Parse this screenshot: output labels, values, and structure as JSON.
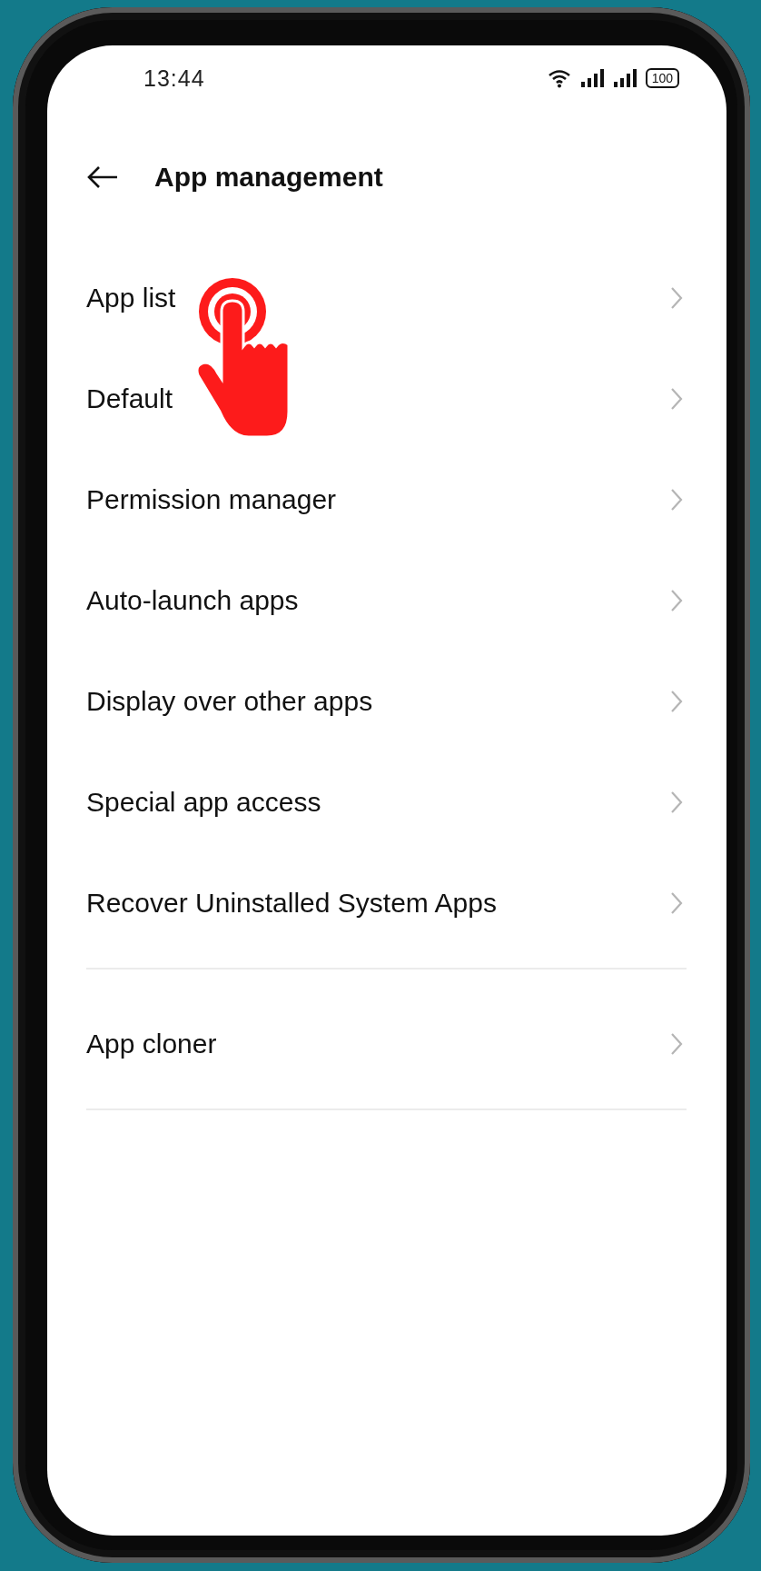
{
  "status_bar": {
    "time": "13:44",
    "battery": "100"
  },
  "header": {
    "title": "App management"
  },
  "sections": [
    {
      "items": [
        {
          "label": "App list"
        },
        {
          "label": "Default"
        },
        {
          "label": "Permission manager"
        },
        {
          "label": "Auto-launch apps"
        },
        {
          "label": "Display over other apps"
        },
        {
          "label": "Special app access"
        },
        {
          "label": "Recover Uninstalled System Apps"
        }
      ]
    },
    {
      "items": [
        {
          "label": "App cloner"
        }
      ]
    }
  ]
}
